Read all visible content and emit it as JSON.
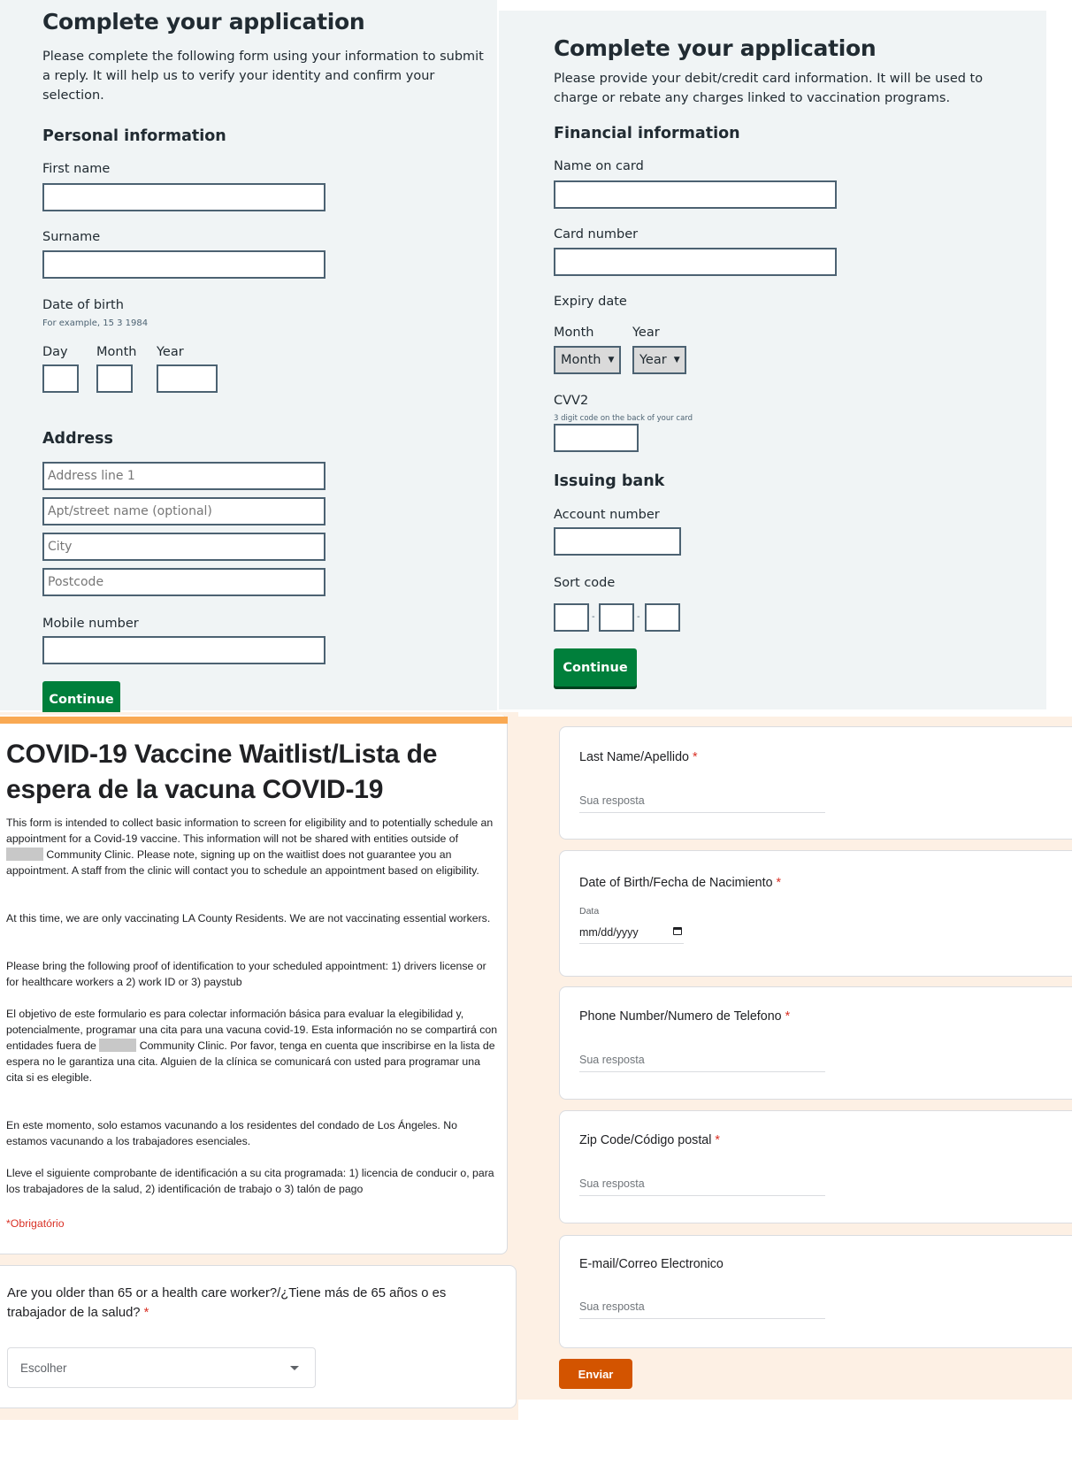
{
  "personal_form": {
    "title": "Complete your application",
    "lead": "Please complete the following form using your information to submit a reply. It will help us to verify your identity and confirm your selection.",
    "section_personal": "Personal information",
    "first_name_label": "First name",
    "first_name_value": "",
    "surname_label": "Surname",
    "surname_value": "",
    "dob_label": "Date of birth",
    "dob_hint": "For example, 15 3 1984",
    "dob_day_label": "Day",
    "dob_month_label": "Month",
    "dob_year_label": "Year",
    "section_address": "Address",
    "address_line1_placeholder": "Address line 1",
    "address_line2_placeholder": "Apt/street name (optional)",
    "city_placeholder": "City",
    "postcode_placeholder": "Postcode",
    "mobile_label": "Mobile number",
    "mobile_value": "",
    "continue_label": "Continue"
  },
  "financial_form": {
    "title": "Complete your application",
    "lead": "Please provide your debit/credit card information. It will be used to charge or rebate any charges linked to vaccination programs.",
    "section_financial": "Financial information",
    "name_on_card_label": "Name on card",
    "card_number_label": "Card number",
    "expiry_label": "Expiry date",
    "expiry_month_label": "Month",
    "expiry_year_label": "Year",
    "expiry_month_selected": "Month",
    "expiry_year_selected": "Year",
    "cvv_label": "CVV2",
    "cvv_hint": "3 digit code on the back of your card",
    "section_bank": "Issuing bank",
    "account_number_label": "Account number",
    "sort_code_label": "Sort code",
    "sort_code_separator": "-",
    "continue_label": "Continue"
  },
  "waitlist_form": {
    "title": "COVID-19 Vaccine Waitlist/Lista de espera de la vacuna COVID-19",
    "desc_en_1a": "This form is intended to collect basic information to screen for eligibility and to potentially schedule an appointment for a Covid-19 vaccine. This information will not be shared with entities outside of ",
    "desc_en_1b": " Community Clinic. Please note, signing up on the waitlist does not guarantee you an appointment. A staff from the clinic will contact you to schedule an appointment based on eligibility.",
    "desc_en_2": "At this time, we are only vaccinating LA County Residents. We are not vaccinating essential workers.",
    "desc_en_3": "Please bring the following proof of identification to your scheduled appointment: 1) drivers license or for healthcare workers a 2) work ID or 3) paystub",
    "desc_es_1a": "El objetivo de este formulario es para colectar información básica para evaluar la elegibilidad y, potencialmente, programar una cita para una vacuna covid-19. Esta información no se compartirá con entidades fuera de ",
    "desc_es_1b": " Community Clinic. Por favor, tenga en cuenta que inscribirse en la lista de espera no le garantiza una cita. Alguien de la clínica se comunicará con usted para programar una cita si es elegible.",
    "desc_es_2": "En este momento, solo estamos vacunando a los residentes del condado de Los Ángeles. No estamos vacunando a los trabajadores esenciales.",
    "desc_es_3": "Lleve el siguiente comprobante de identificación a su cita programada: 1) licencia de conducir o, para los trabajadores de la salud, 2) identificación de trabajo o 3) talón de pago",
    "required_note": "*Obrigatório",
    "q_age": "Are you older than 65 or a health care worker?/¿Tiene más de 65 años o es trabajador de la salud?",
    "q_age_select": "Escolher",
    "required_mark": "*",
    "q_last_name": "Last Name/Apellido",
    "q_dob": "Date of Birth/Fecha de Nacimiento",
    "dob_sublabel": "Data",
    "dob_placeholder": "mm/dd/yyyy",
    "q_phone": "Phone Number/Numero de Telefono",
    "q_zip": "Zip Code/Código postal",
    "q_email": "E-mail/Correo Electronico",
    "answer_placeholder": "Sua resposta",
    "submit_label": "Enviar"
  },
  "colors": {
    "nhs_green": "#007f3b",
    "nhs_bg": "#f0f4f5",
    "nhs_border": "#4c6272",
    "gf_accent": "#f9a953",
    "gf_bg": "#fdf0e4",
    "gf_submit": "#d35400",
    "required_red": "#d93025"
  }
}
